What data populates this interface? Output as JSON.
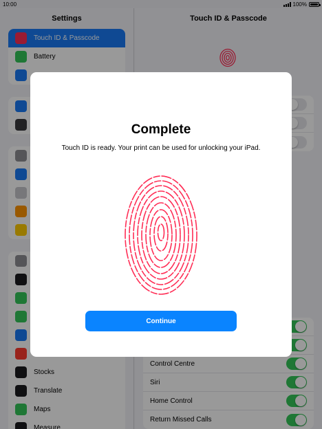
{
  "status_bar": {
    "time": "10:00",
    "battery": "100%"
  },
  "sidebar": {
    "title": "Settings",
    "groups": [
      [
        {
          "label": "Touch ID & Passcode",
          "selected": true,
          "color": "#ff2d55"
        },
        {
          "label": "Battery",
          "color": "#34c759"
        },
        {
          "label": "",
          "color": "#1a7bf6"
        }
      ],
      [
        {
          "label": "",
          "color": "#1a7bf6"
        },
        {
          "label": "",
          "color": "#3a3a3c"
        }
      ],
      [
        {
          "label": "",
          "color": "#8e8e93"
        },
        {
          "label": "",
          "color": "#1a7bf6"
        },
        {
          "label": "",
          "color": "#c7c7cc"
        },
        {
          "label": "",
          "color": "#ff9500"
        },
        {
          "label": "",
          "color": "#ffcc00"
        }
      ],
      [
        {
          "label": "",
          "color": "#8e8e93"
        },
        {
          "label": "",
          "color": "#1c1c1e"
        },
        {
          "label": "",
          "color": "#34c759"
        },
        {
          "label": "",
          "color": "#34c759"
        },
        {
          "label": "",
          "color": "#1a7bf6"
        },
        {
          "label": "",
          "color": "#ff3b30"
        },
        {
          "label": "Stocks",
          "color": "#1c1c1e"
        },
        {
          "label": "Translate",
          "color": "#1c1c1e"
        },
        {
          "label": "Maps",
          "color": "#34c759"
        },
        {
          "label": "Measure",
          "color": "#1c1c1e"
        }
      ]
    ]
  },
  "detail": {
    "title": "Touch ID & Passcode",
    "access_rows": [
      {
        "label": "Control Centre",
        "on": true
      },
      {
        "label": "Siri",
        "on": true
      },
      {
        "label": "Home Control",
        "on": true
      },
      {
        "label": "Return Missed Calls",
        "on": true
      }
    ]
  },
  "modal": {
    "title": "Complete",
    "message": "Touch ID is ready. Your print can be used for unlocking your iPad.",
    "continue_label": "Continue",
    "fingerprint_color": "#ff2d55"
  }
}
